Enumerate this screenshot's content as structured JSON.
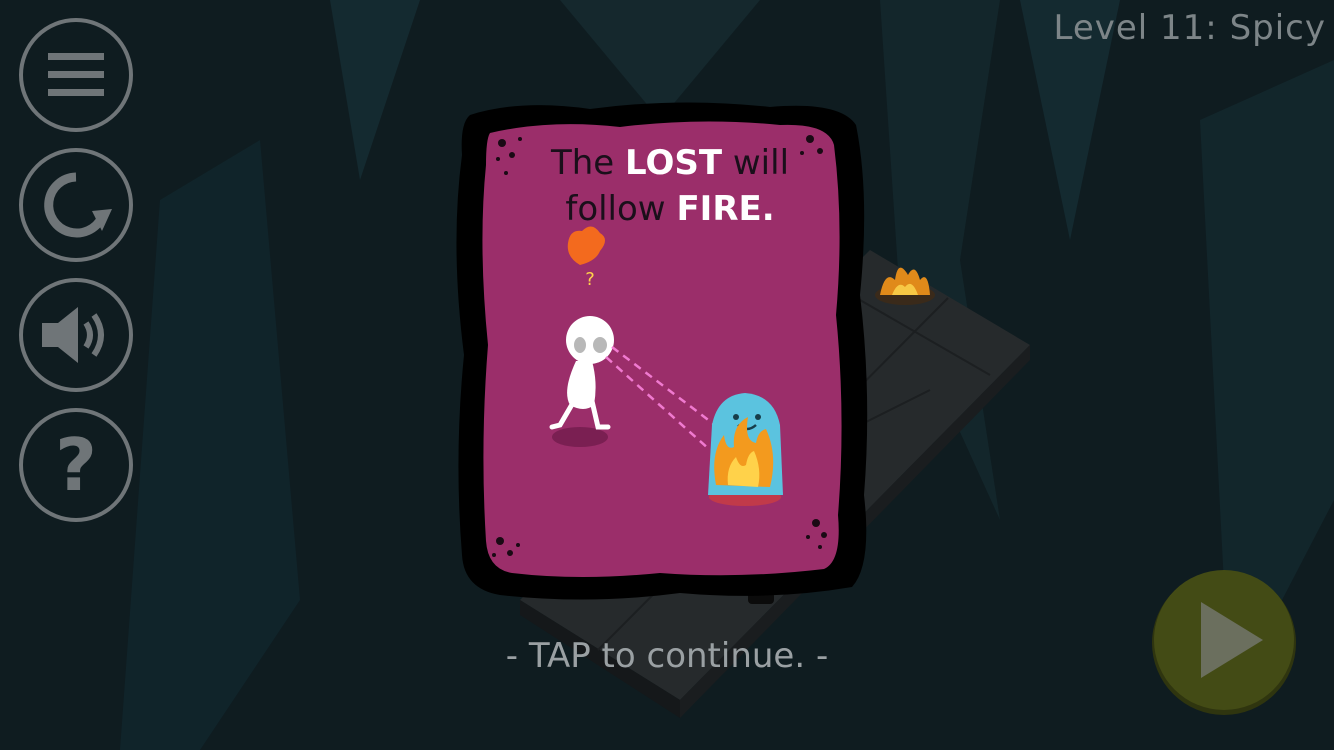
{
  "hud": {
    "level_title": "Level 11: Spicy",
    "buttons": [
      {
        "name": "menu",
        "icon": "hamburger-menu-icon"
      },
      {
        "name": "restart",
        "icon": "restart-icon"
      },
      {
        "name": "sound",
        "icon": "speaker-icon"
      },
      {
        "name": "help",
        "icon": "question-mark-icon",
        "glyph": "?"
      }
    ],
    "play_icon": "play-icon"
  },
  "tutorial_card": {
    "line1_prefix": "The",
    "line1_highlight": "LOST",
    "line1_suffix": "will",
    "line2_prefix": "follow",
    "line2_highlight": "FIRE.",
    "question_glyph": "?",
    "card_color": "#9b2e6a"
  },
  "prompt": {
    "tap_text": "- TAP to continue. -"
  },
  "colors": {
    "background": "#0f1c20",
    "hud_gray": "#6f7578",
    "play_button": "#434b15",
    "ghost": "#5bc3df",
    "fire": "#f39a1e"
  }
}
